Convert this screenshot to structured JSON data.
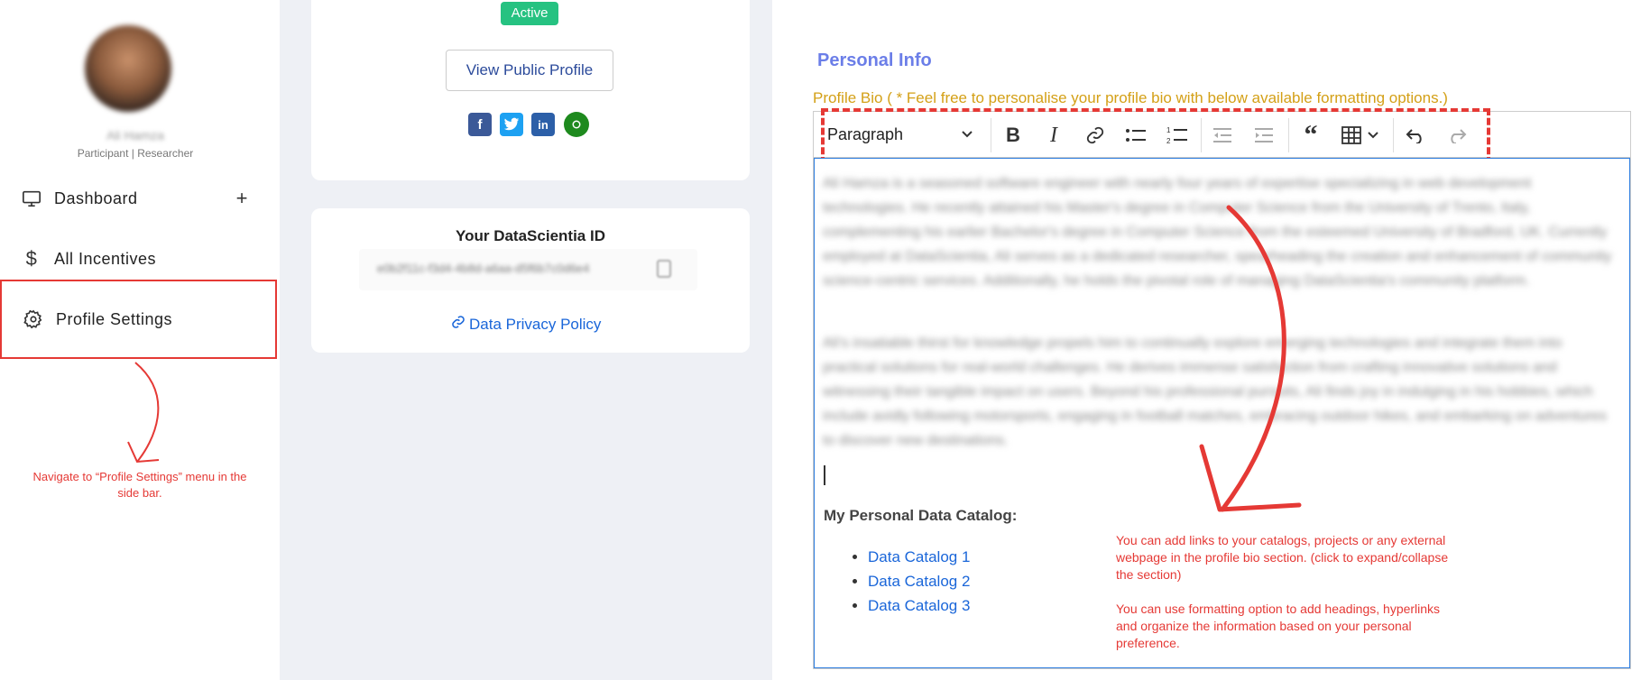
{
  "sidebar": {
    "user_name": "Ali Hamza",
    "user_role": "Participant | Researcher",
    "items": [
      {
        "label": "Dashboard",
        "icon": "monitor-icon",
        "expand": "+"
      },
      {
        "label": "All Incentives",
        "icon": "dollar-icon"
      },
      {
        "label": "Profile Settings",
        "icon": "gear-icon"
      }
    ],
    "annotation": "Navigate to “Profile Settings” menu in the side bar."
  },
  "profile_card": {
    "status": "Active",
    "public_profile_button": "View Public Profile",
    "socials": [
      "facebook-icon",
      "twitter-icon",
      "linkedin-icon",
      "chrome-icon"
    ]
  },
  "id_card": {
    "title": "Your DataScientia ID",
    "id_value": "e0b2f11c-f3d4-4b8d-a6aa-d5f6b7c0d6e4",
    "privacy_link": "Data Privacy Policy"
  },
  "personal_info": {
    "title": "Personal Info",
    "bio_label": "Profile Bio ( * Feel free to personalise your profile bio with below available formatting options.)",
    "toolbar": {
      "paragraph": "Paragraph",
      "icons": [
        "bold-icon",
        "italic-icon",
        "link-icon",
        "bulleted-list-icon",
        "numbered-list-icon",
        "outdent-icon",
        "indent-icon",
        "blockquote-icon",
        "table-icon",
        "undo-icon",
        "redo-icon"
      ]
    },
    "bio_paragraph_1": "Ali Hamza is a seasoned software engineer with nearly four years of expertise specializing in web development technologies. He recently attained his Master's degree in Computer Science from the University of Trento, Italy, complementing his earlier Bachelor's degree in Computer Science from the esteemed University of Bradford, UK. Currently employed at DataScientia, Ali serves as a dedicated researcher, spearheading the creation and enhancement of community science-centric services. Additionally, he holds the pivotal role of managing DataScientia's community platform.",
    "bio_paragraph_2": "Ali's insatiable thirst for knowledge propels him to continually explore emerging technologies and integrate them into practical solutions for real-world challenges. He derives immense satisfaction from crafting innovative solutions and witnessing their tangible impact on users. Beyond his professional pursuits, Ali finds joy in indulging in his hobbies, which include avidly following motorsports, engaging in football matches, embracing outdoor hikes, and embarking on adventures to discover new destinations.",
    "catalog_title": "My Personal Data Catalog:",
    "catalogs": [
      "Data Catalog 1",
      "Data Catalog 2",
      "Data Catalog 3"
    ],
    "annotation": "You can add links to your catalogs, projects or any external webpage in the profile bio section. (click to expand/collapse the section)\n\n You can use formatting option to add headings, hyperlinks and organize the information based on your personal preference."
  },
  "colors": {
    "annotation": "#e53935",
    "active_badge": "#26c281",
    "link": "#1a66d9",
    "section_title": "#6b7ee8",
    "bio_label": "#d4a017"
  }
}
